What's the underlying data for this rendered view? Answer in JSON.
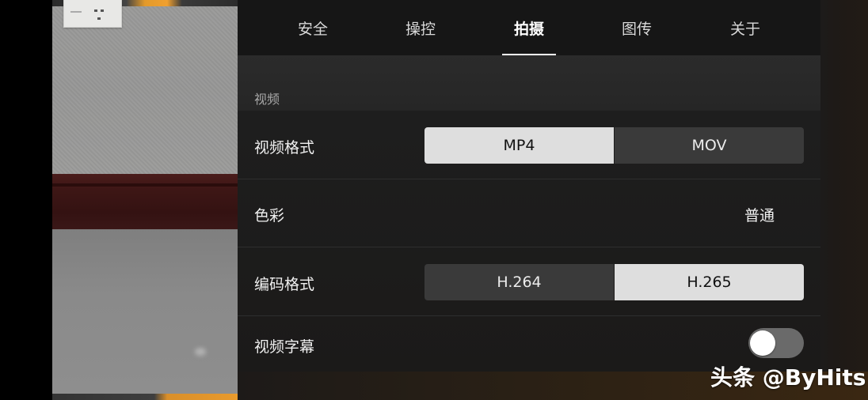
{
  "tabs": [
    {
      "label": "安全",
      "active": false
    },
    {
      "label": "操控",
      "active": false
    },
    {
      "label": "拍摄",
      "active": true
    },
    {
      "label": "图传",
      "active": false
    },
    {
      "label": "关于",
      "active": false
    }
  ],
  "section": {
    "title": "视频"
  },
  "settings": {
    "video_format": {
      "label": "视频格式",
      "options": [
        "MP4",
        "MOV"
      ],
      "selected": "MP4"
    },
    "color": {
      "label": "色彩",
      "value": "普通"
    },
    "encoding_format": {
      "label": "编码格式",
      "options": [
        "H.264",
        "H.265"
      ],
      "selected": "H.265"
    },
    "video_subtitles": {
      "label": "视频字幕",
      "enabled": false
    }
  },
  "watermark": "头条 @ByHits",
  "colors": {
    "accent": "#ffffff",
    "selected_segment": "#dedede",
    "unselected_segment": "#3a3a3a",
    "toggle_off": "#6a6a6a",
    "panel_background": "#1c1c1c"
  }
}
